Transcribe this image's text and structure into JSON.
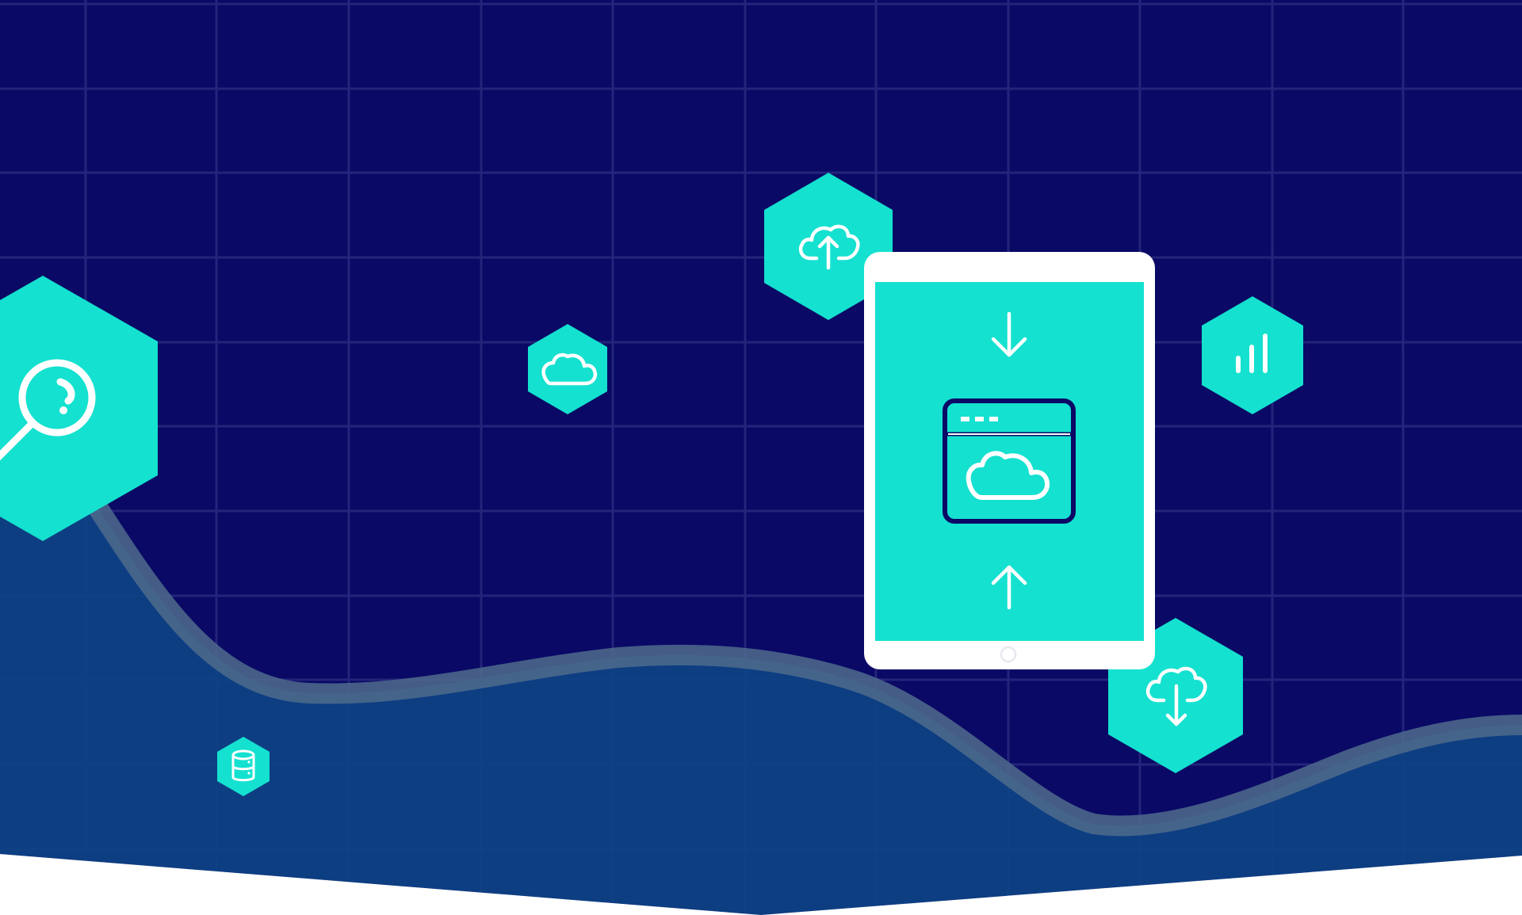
{
  "colors": {
    "background": "#0a0966",
    "grid": "#23257a",
    "wave_fill": "#0e4184",
    "wave_stroke": "#4f6b8c",
    "accent": "#14e1cf",
    "device_frame": "#ffffff",
    "device_screen": "#14e1cf",
    "icon_stroke": "#ffffff",
    "window_stroke": "#0a0966",
    "page_bottom": "#ffffff"
  },
  "illustration": {
    "subject": "tablet-cloud-sync",
    "hexagons": [
      {
        "role": "search",
        "icon": "magnifying-glass-icon"
      },
      {
        "role": "cloud",
        "icon": "cloud-icon"
      },
      {
        "role": "upload",
        "icon": "cloud-upload-icon"
      },
      {
        "role": "analytics",
        "icon": "bar-chart-icon"
      },
      {
        "role": "download",
        "icon": "cloud-download-icon"
      },
      {
        "role": "database",
        "icon": "database-icon"
      }
    ],
    "tablet": {
      "screen_icons": [
        "arrow-down-icon",
        "browser-cloud-icon",
        "arrow-up-icon"
      ]
    }
  }
}
